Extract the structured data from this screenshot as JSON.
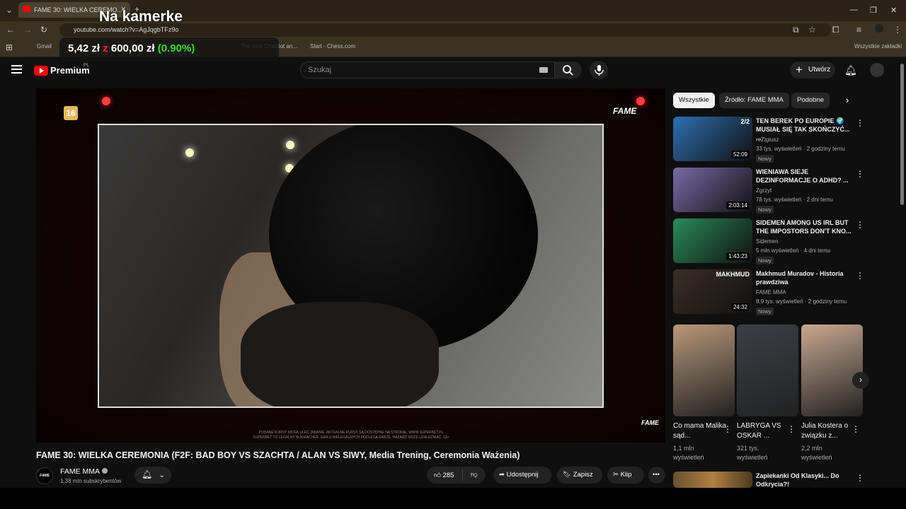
{
  "browser": {
    "tab_title": "FAME 30: WIELKA CEREMO...",
    "url": "youtube.com/watch?v=AgJqgbTFz9o",
    "bookmarks": [
      "Gmail",
      "The best ChatBot an...",
      "Start - Chess.com"
    ],
    "bookmarks_right": "Wszystkie zakładki"
  },
  "overlay": {
    "title": "Na kamerke",
    "stock_prefix": "5,42 zł",
    "stock_mid": "z",
    "stock_value": "600,00 zł",
    "stock_pct": "(0.90%)",
    "pct_color": "#3ddc2e"
  },
  "header": {
    "brand": "Premium",
    "region": "PL",
    "search_placeholder": "Szukaj",
    "create_label": "Utwórz"
  },
  "player": {
    "age_rating": "16",
    "brand_top": "FAME",
    "brand_bottom": "FAME",
    "disclaimer_1": "PODANE KURSY MOGĄ ULEC ZMIANIE. AKTUALNE KURSY SĄ DOSTĘPNE NA STRONIE: WWW.SUPERBET.PL",
    "disclaimer_2": "SUPERBET TO LEGALNY BUKMACHER. GRA U NIELEGALNYCH PODLEGA KARZE. HAZARD MOŻE UZALEŻNIAĆ. 18+"
  },
  "video": {
    "title": "FAME 30: WIELKA CEREMONIA (F2F: BAD BOY VS SZACHTA / ALAN VS SIWY, Media Trening, Ceremonia Ważenia)",
    "channel": "FAME MMA",
    "channel_avatar_text": "FAME",
    "subscribers": "1,38 mln subskrybentów",
    "likes": "285",
    "share_label": "Udostępnij",
    "save_label": "Zapisz",
    "clip_label": "Klip"
  },
  "chips": [
    "Wszystkie",
    "Źródło: FAME MMA",
    "Podobne"
  ],
  "recommendations": [
    {
      "title": "TEN BEREK PO EUROPIE 🌍 MUSIAŁ SIĘ TAK SKOŃCZYĆ... ...",
      "channel": "reZigiusz",
      "meta": "33 tys. wyświetleń · 2 godziny temu",
      "badge": "Nowy",
      "duration": "52:09",
      "overlay": "2/2",
      "thumb_color": "#2e6fb0"
    },
    {
      "title": "WIENIAWA SIEJE DEZINFORMACJE O ADHD? ...",
      "channel": "Zgrzyt",
      "meta": "78 tys. wyświetleń · 2 dni temu",
      "badge": "Nowy",
      "duration": "2:03:14",
      "overlay": "",
      "thumb_color": "#7a6aa8"
    },
    {
      "title": "SIDEMEN AMONG US IRL BUT THE IMPOSTORS DON'T KNO...",
      "channel": "Sidemen",
      "meta": "5 mln wyświetleń · 4 dni temu",
      "badge": "Nowy",
      "duration": "1:43:23",
      "overlay": "",
      "thumb_color": "#2a8a5a"
    },
    {
      "title": "Makhmud Muradov - Historia prawdziwa",
      "channel": "FAME MMA",
      "meta": "8,9 tys. wyświetleń · 2 godziny temu",
      "badge": "Nowy",
      "duration": "24:32",
      "overlay": "MAKHMUD",
      "thumb_color": "#3a2e26"
    }
  ],
  "shorts": [
    {
      "title": "Co mama Malika sąd...",
      "views_1": "1,1 mln",
      "views_2": "wyświetleń",
      "thumb_color": "#b9977a"
    },
    {
      "title": "LABRYGA VS OSKAR ...",
      "views_1": "321 tys.",
      "views_2": "wyświetleń",
      "thumb_color": "#3b4046"
    },
    {
      "title": "Julia Kostera o związku z...",
      "views_1": "2,2 mln",
      "views_2": "wyświetleń",
      "thumb_color": "#c9a890"
    }
  ],
  "bottom_rec": {
    "title": "Zapiekanki Od Klasyki... Do Odkrycia?!"
  }
}
